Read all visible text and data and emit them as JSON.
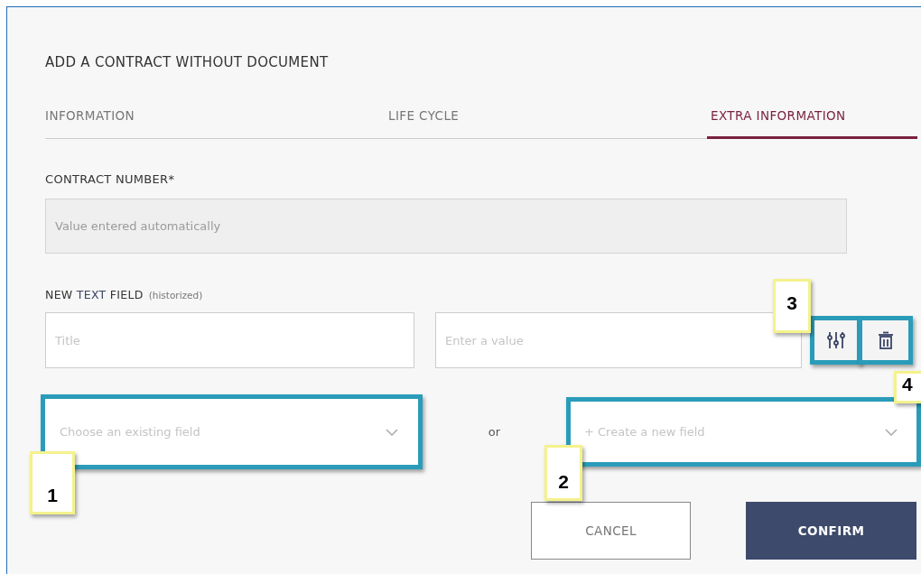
{
  "dialog": {
    "title": "ADD A CONTRACT WITHOUT DOCUMENT"
  },
  "tabs": [
    {
      "label": "INFORMATION",
      "selected": false
    },
    {
      "label": "LIFE CYCLE",
      "selected": false
    },
    {
      "label": "EXTRA INFORMATION",
      "selected": true
    }
  ],
  "contract_number": {
    "label": "CONTRACT NUMBER*",
    "placeholder": "Value entered automatically",
    "disabled": true
  },
  "new_text_field": {
    "label": "NEW **TEXT** FIELD",
    "note": "(historized)",
    "title_placeholder": "Title",
    "value_placeholder": "Enter a value"
  },
  "choose_field": {
    "placeholder": "Choose an existing field"
  },
  "separator": "or",
  "create_field": {
    "placeholder": "+ Create a new field"
  },
  "buttons": [
    {
      "label": "CANCEL",
      "kind": "secondary"
    },
    {
      "label": "CONFIRM",
      "kind": "primary"
    }
  ],
  "callouts": [
    {
      "number": "1"
    },
    {
      "number": "2"
    },
    {
      "number": "3"
    },
    {
      "number": "4"
    }
  ]
}
